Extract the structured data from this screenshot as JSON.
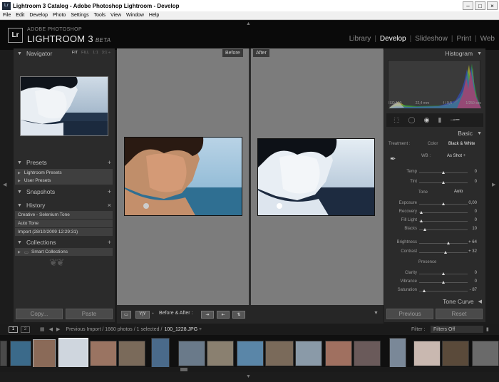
{
  "window": {
    "title": "Lightroom 3 Catalog - Adobe Photoshop Lightroom - Develop",
    "min": "–",
    "max": "□",
    "close": "×"
  },
  "menu": [
    "File",
    "Edit",
    "Develop",
    "Photo",
    "Settings",
    "Tools",
    "View",
    "Window",
    "Help"
  ],
  "identity": {
    "badge": "Lr",
    "line1": "ADOBE PHOTOSHOP",
    "line2": "LIGHTROOM 3",
    "beta": "BETA"
  },
  "modules": [
    "Library",
    "Develop",
    "Slideshow",
    "Print",
    "Web"
  ],
  "active_module": "Develop",
  "left": {
    "navigator": {
      "title": "Navigator",
      "options": [
        "FIT",
        "FILL",
        "1:1",
        "3:1 ÷"
      ]
    },
    "presets": {
      "title": "Presets",
      "items": [
        "Lightroom Presets",
        "User Presets"
      ]
    },
    "snapshots": {
      "title": "Snapshots"
    },
    "history": {
      "title": "History",
      "items": [
        "Creative - Selenium Tone",
        "Auto Tone",
        "Import (28/10/2009 12:29:31)"
      ]
    },
    "collections": {
      "title": "Collections",
      "items": [
        "Smart Collections"
      ]
    },
    "copy_btn": "Copy...",
    "paste_btn": "Paste"
  },
  "center": {
    "before_label": "Before",
    "after_label": "After"
  },
  "toolbar": {
    "yy": "Y|Y",
    "caption": "Before & After :"
  },
  "right": {
    "histogram": {
      "title": "Histogram",
      "iso": "ISO 100",
      "focal": "22,4 mm",
      "aperture": "f / 9,5",
      "shutter": "1/250 sec"
    },
    "basic": {
      "title": "Basic",
      "treatment_label": "Treatment :",
      "color": "Color",
      "bw": "Black & White",
      "wb_label": "WB :",
      "wb_value": "As Shot ÷",
      "tone_label": "Tone",
      "auto": "Auto",
      "presence_label": "Presence"
    },
    "sliders": [
      {
        "label": "Temp",
        "value": "0",
        "pos": 0.5
      },
      {
        "label": "Tint",
        "value": "0",
        "pos": 0.5
      },
      {
        "label": "Exposure",
        "value": "0,00",
        "pos": 0.5
      },
      {
        "label": "Recovery",
        "value": "0",
        "pos": 0.05
      },
      {
        "label": "Fill Light",
        "value": "0",
        "pos": 0.05
      },
      {
        "label": "Blacks",
        "value": "10",
        "pos": 0.12
      },
      {
        "label": "Brightness",
        "value": "+ 64",
        "pos": 0.6
      },
      {
        "label": "Contrast",
        "value": "+ 32",
        "pos": 0.55
      },
      {
        "label": "Clarity",
        "value": "0",
        "pos": 0.5
      },
      {
        "label": "Vibrance",
        "value": "0",
        "pos": 0.5
      },
      {
        "label": "Saturation",
        "value": "- 87",
        "pos": 0.1
      }
    ],
    "tonecurve": "Tone Curve",
    "previous_btn": "Previous",
    "reset_btn": "Reset"
  },
  "filmstrip": {
    "page1": "1",
    "page2": "2",
    "path": "Previous Import / 1660 photos / 1 selected /",
    "file": "100_1228.JPG ÷",
    "filter_label": "Filter :",
    "filter_value": "Filters Off"
  }
}
